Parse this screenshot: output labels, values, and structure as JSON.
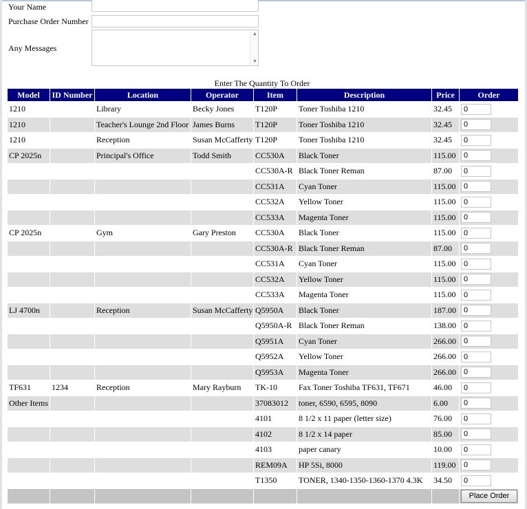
{
  "form": {
    "name_label": "Your Name",
    "po_label": "Purchase Order Number",
    "messages_label": "Any Messages"
  },
  "caption": "Enter The Quantity To Order",
  "table": {
    "headers": [
      "Model",
      "ID Number",
      "Location",
      "Operator",
      "Item",
      "Description",
      "Price",
      "Order"
    ],
    "rows": [
      {
        "model": "1210",
        "id": "",
        "location": "Library",
        "operator": "Becky Jones",
        "item": "T120P",
        "description": "Toner Toshiba 1210",
        "price": "32.45",
        "qty": "0"
      },
      {
        "model": "1210",
        "id": "",
        "location": "Teacher's Lounge 2nd Floor",
        "operator": "James Burns",
        "item": "T120P",
        "description": "Toner Toshiba 1210",
        "price": "32.45",
        "qty": "0"
      },
      {
        "model": "1210",
        "id": "",
        "location": "Reception",
        "operator": "Susan McCafferty",
        "item": "T120P",
        "description": "Toner Toshiba 1210",
        "price": "32.45",
        "qty": "0"
      },
      {
        "model": "CP 2025n",
        "id": "",
        "location": "Principal's Office",
        "operator": "Todd Smith",
        "item": "CC530A",
        "description": "Black Toner",
        "price": "115.00",
        "qty": "0"
      },
      {
        "model": "",
        "id": "",
        "location": "",
        "operator": "",
        "item": "CC530A-R",
        "description": "Black Toner Reman",
        "price": "87.00",
        "qty": "0"
      },
      {
        "model": "",
        "id": "",
        "location": "",
        "operator": "",
        "item": "CC531A",
        "description": "Cyan Toner",
        "price": "115.00",
        "qty": "0"
      },
      {
        "model": "",
        "id": "",
        "location": "",
        "operator": "",
        "item": "CC532A",
        "description": "Yellow Toner",
        "price": "115.00",
        "qty": "0"
      },
      {
        "model": "",
        "id": "",
        "location": "",
        "operator": "",
        "item": "CC533A",
        "description": "Magenta Toner",
        "price": "115.00",
        "qty": "0"
      },
      {
        "model": "CP 2025n",
        "id": "",
        "location": "Gym",
        "operator": "Gary Preston",
        "item": "CC530A",
        "description": "Black Toner",
        "price": "115.00",
        "qty": "0"
      },
      {
        "model": "",
        "id": "",
        "location": "",
        "operator": "",
        "item": "CC530A-R",
        "description": "Black Toner Reman",
        "price": "87.00",
        "qty": "0"
      },
      {
        "model": "",
        "id": "",
        "location": "",
        "operator": "",
        "item": "CC531A",
        "description": "Cyan Toner",
        "price": "115.00",
        "qty": "0"
      },
      {
        "model": "",
        "id": "",
        "location": "",
        "operator": "",
        "item": "CC532A",
        "description": "Yellow Toner",
        "price": "115.00",
        "qty": "0"
      },
      {
        "model": "",
        "id": "",
        "location": "",
        "operator": "",
        "item": "CC533A",
        "description": "Magenta Toner",
        "price": "115.00",
        "qty": "0"
      },
      {
        "model": "LJ 4700n",
        "id": "",
        "location": "Reception",
        "operator": "Susan McCafferty",
        "item": "Q5950A",
        "description": "Black Toner",
        "price": "187.00",
        "qty": "0"
      },
      {
        "model": "",
        "id": "",
        "location": "",
        "operator": "",
        "item": "Q5950A-R",
        "description": "Black Toner Reman",
        "price": "138.00",
        "qty": "0"
      },
      {
        "model": "",
        "id": "",
        "location": "",
        "operator": "",
        "item": "Q5951A",
        "description": "Cyan Toner",
        "price": "266.00",
        "qty": "0"
      },
      {
        "model": "",
        "id": "",
        "location": "",
        "operator": "",
        "item": "Q5952A",
        "description": "Yellow Toner",
        "price": "266.00",
        "qty": "0"
      },
      {
        "model": "",
        "id": "",
        "location": "",
        "operator": "",
        "item": "Q5953A",
        "description": "Magenta Toner",
        "price": "266.00",
        "qty": "0"
      },
      {
        "model": "TF631",
        "id": "1234",
        "location": "Reception",
        "operator": "Mary Rayburn",
        "item": "TK-10",
        "description": "Fax Toner Toshiba TF631, TF671",
        "price": "46.00",
        "qty": "0"
      },
      {
        "model": "Other Items",
        "id": "",
        "location": "",
        "operator": "",
        "item": "37083012",
        "description": "toner, 6590, 6595, 8090",
        "price": "6.00",
        "qty": "0"
      },
      {
        "model": "",
        "id": "",
        "location": "",
        "operator": "",
        "item": "4101",
        "description": "8 1/2 x 11 paper (letter size)",
        "price": "76.00",
        "qty": "0"
      },
      {
        "model": "",
        "id": "",
        "location": "",
        "operator": "",
        "item": "4102",
        "description": "8 1/2 x 14 paper",
        "price": "85.00",
        "qty": "0"
      },
      {
        "model": "",
        "id": "",
        "location": "",
        "operator": "",
        "item": "4103",
        "description": "paper canary",
        "price": "10.00",
        "qty": "0"
      },
      {
        "model": "",
        "id": "",
        "location": "",
        "operator": "",
        "item": "REM09A",
        "description": "HP 5Si, 8000",
        "price": "119.00",
        "qty": "0"
      },
      {
        "model": "",
        "id": "",
        "location": "",
        "operator": "",
        "item": "T1350",
        "description": "TONER, 1340-1350-1360-1370 4.3K",
        "price": "34.50",
        "qty": "0"
      }
    ],
    "submit_label": "Place Order"
  }
}
